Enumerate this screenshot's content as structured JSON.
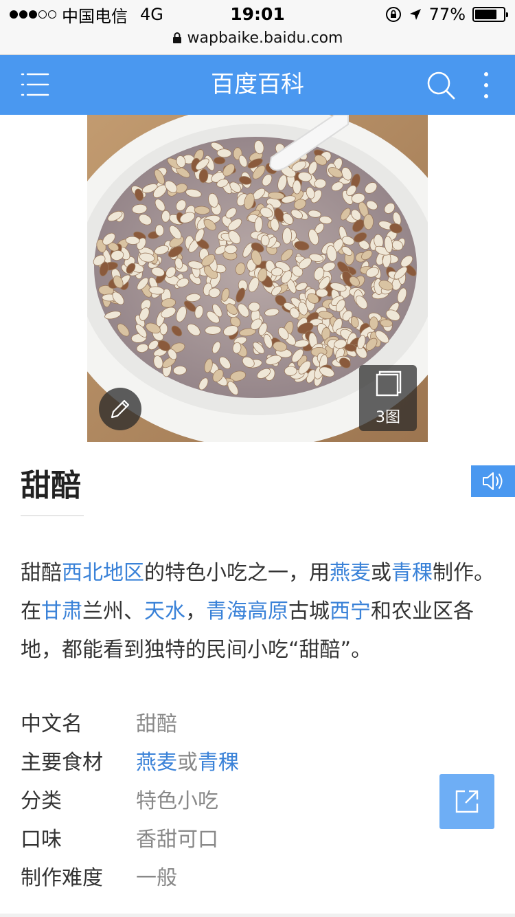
{
  "status_bar": {
    "carrier": "中国电信",
    "network": "4G",
    "time": "19:01",
    "battery_percent": "77%",
    "battery_level": 0.77,
    "url": "wapbaike.baidu.com"
  },
  "navbar": {
    "title": "百度百科",
    "color": "#4a98f0"
  },
  "hero": {
    "image_count_label": "3图"
  },
  "article": {
    "title": "甜醅",
    "summary": [
      {
        "text": "甜醅",
        "link": false
      },
      {
        "text": "西北地区",
        "link": true
      },
      {
        "text": "的特色小吃之一，用",
        "link": false
      },
      {
        "text": "燕麦",
        "link": true
      },
      {
        "text": "或",
        "link": false
      },
      {
        "text": "青稞",
        "link": true
      },
      {
        "text": "制作。在",
        "link": false
      },
      {
        "text": "甘肃",
        "link": true
      },
      {
        "text": "兰州、",
        "link": false
      },
      {
        "text": "天水",
        "link": true
      },
      {
        "text": "，",
        "link": false
      },
      {
        "text": "青海高原",
        "link": true
      },
      {
        "text": "古城",
        "link": false
      },
      {
        "text": "西宁",
        "link": true
      },
      {
        "text": "和农业区各地，都能看到独特的民间小吃“甜醅”。",
        "link": false
      }
    ]
  },
  "basic_info": [
    {
      "key": "中文名",
      "value": [
        {
          "text": "甜醅",
          "link": false
        }
      ]
    },
    {
      "key": "主要食材",
      "value": [
        {
          "text": "燕麦",
          "link": true
        },
        {
          "text": "或",
          "link": false
        },
        {
          "text": "青稞",
          "link": true
        }
      ]
    },
    {
      "key": "分类",
      "value": [
        {
          "text": "特色小吃",
          "link": false
        }
      ]
    },
    {
      "key": "口味",
      "value": [
        {
          "text": "香甜可口",
          "link": false
        }
      ]
    },
    {
      "key": "制作难度",
      "value": [
        {
          "text": "一般",
          "link": false
        }
      ]
    }
  ],
  "colors": {
    "accent": "#4a98f0",
    "link": "#3a82d8",
    "muted_text": "#888888"
  }
}
